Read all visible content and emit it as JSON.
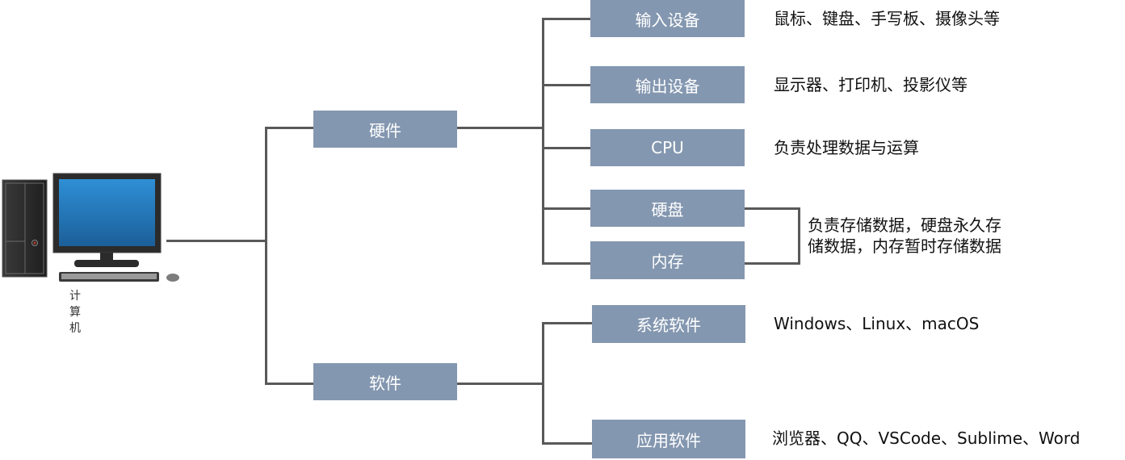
{
  "root": {
    "label": "计算机",
    "icon": "desktop-computer-icon"
  },
  "hardware": {
    "label": "硬件",
    "children": [
      {
        "label": "输入设备",
        "desc": "鼠标、键盘、手写板、摄像头等"
      },
      {
        "label": "输出设备",
        "desc": "显示器、打印机、投影仪等"
      },
      {
        "label": "CPU",
        "desc": "负责处理数据与运算"
      },
      {
        "label": "硬盘"
      },
      {
        "label": "内存"
      }
    ],
    "storage_desc_line1": "负责存储数据，硬盘永久存",
    "storage_desc_line2": "储数据，内存暂时存储数据"
  },
  "software": {
    "label": "软件",
    "children": [
      {
        "label": "系统软件",
        "desc": "Windows、Linux、macOS"
      },
      {
        "label": "应用软件",
        "desc": "浏览器、QQ、VSCode、Sublime、Word"
      }
    ]
  },
  "colors": {
    "box": "#8497b0",
    "line": "#595959",
    "text": "#111111"
  }
}
